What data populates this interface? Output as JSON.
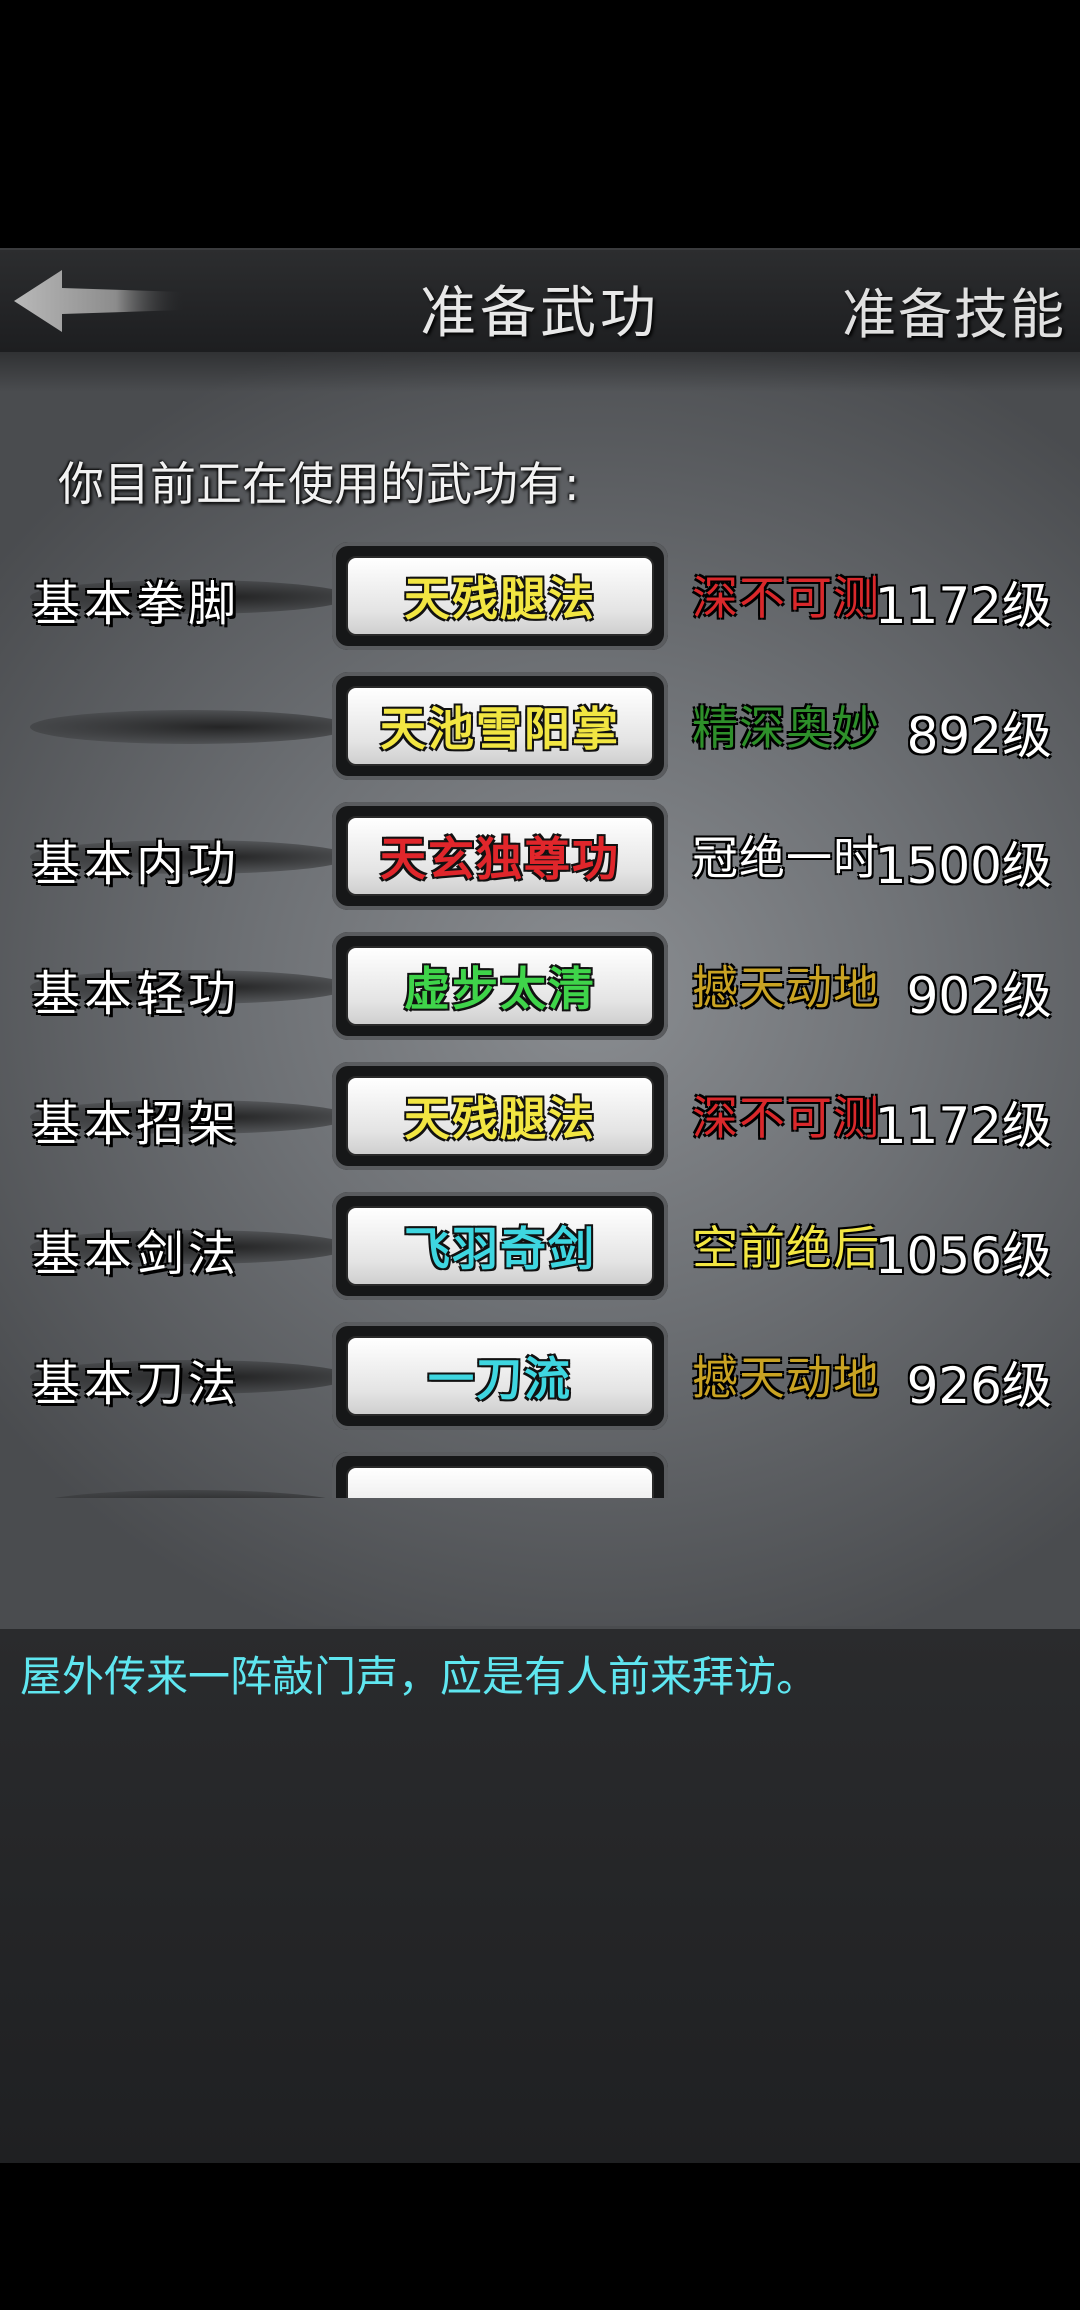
{
  "header": {
    "title": "准备武功",
    "right_label": "准备技能",
    "back_icon": "back-arrow-icon"
  },
  "intro": "你目前正在使用的武功有:",
  "skills": [
    {
      "category": "基本拳脚",
      "name": "天残腿法",
      "name_color": "#f2e642",
      "rank": "深不可测",
      "rank_color": "#d9282b",
      "level": "1172级"
    },
    {
      "category": "",
      "name": "天池雪阳掌",
      "name_color": "#f2e642",
      "rank": "精深奥妙",
      "rank_color": "#2e8f2a",
      "level": "892级"
    },
    {
      "category": "基本内功",
      "name": "天玄独尊功",
      "name_color": "#e0262b",
      "rank": "冠绝一时",
      "rank_color": "#ffffff",
      "level": "1500级"
    },
    {
      "category": "基本轻功",
      "name": "虚步太清",
      "name_color": "#3fd44a",
      "rank": "撼天动地",
      "rank_color": "#c9a323",
      "level": "902级"
    },
    {
      "category": "基本招架",
      "name": "天残腿法",
      "name_color": "#f2e642",
      "rank": "深不可测",
      "rank_color": "#d9282b",
      "level": "1172级"
    },
    {
      "category": "基本剑法",
      "name": "飞羽奇剑",
      "name_color": "#3ed6e0",
      "rank": "空前绝后",
      "rank_color": "#f2e642",
      "level": "1056级"
    },
    {
      "category": "基本刀法",
      "name": "一刀流",
      "name_color": "#3ed6e0",
      "rank": "撼天动地",
      "rank_color": "#c9a323",
      "level": "926级"
    },
    {
      "category": "",
      "name": "",
      "name_color": "#ffffff",
      "rank": "",
      "rank_color": "#ffffff",
      "level": ""
    }
  ],
  "message": "屋外传来一阵敲门声，应是有人前来拜访。"
}
